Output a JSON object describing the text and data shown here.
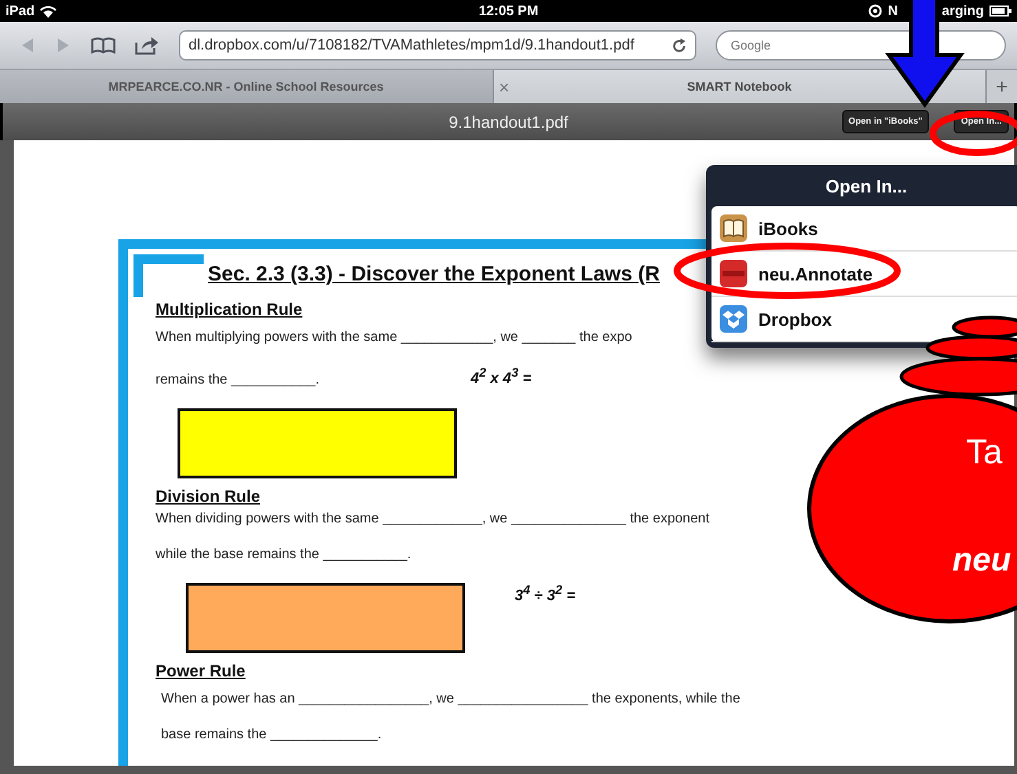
{
  "status_bar": {
    "device": "iPad",
    "time": "12:05 PM",
    "right_text_1": "N",
    "right_text_2": "arging"
  },
  "browser": {
    "url": "dl.dropbox.com/u/7108182/TVAMathletes/mpm1d/9.1handout1.pdf",
    "search_placeholder": "Google",
    "tabs": [
      {
        "label": "MRPEARCE.CO.NR - Online School Resources",
        "selected": false
      },
      {
        "label": "SMART Notebook",
        "selected": true
      }
    ],
    "close_glyph": "×",
    "new_tab_glyph": "+"
  },
  "pdf_bar": {
    "title": "9.1handout1.pdf",
    "buttons": [
      "Open in \"iBooks\"",
      "Open In..."
    ]
  },
  "document": {
    "title": "Sec. 2.3 (3.3) - Discover the Exponent Laws (R",
    "sections": [
      {
        "heading": "Multiplication Rule",
        "kind": "expr-inline",
        "lines": [
          "When multiplying powers with the same ____________, we _______ the expo",
          "remains the ___________."
        ],
        "expression": "4$^{2}$ x 4$^{3}$ =",
        "color": "#ffff00"
      },
      {
        "heading": "Division Rule",
        "kind": "expr-beside-box",
        "lines": [
          "When dividing powers with the same _____________, we _______________ the exponent",
          "while the base remains the ___________."
        ],
        "expression": "3$^{4}$ ÷ 3$^{2}$ =",
        "color": "#ffa95a"
      },
      {
        "heading": "Power Rule",
        "kind": "text-only",
        "lines": [
          "When a power has an _________________, we _________________ the exponents, while the",
          "base remains the ______________."
        ]
      }
    ]
  },
  "popover": {
    "title": "Open In...",
    "items": [
      {
        "label": "iBooks"
      },
      {
        "label": "neu.Annotate"
      },
      {
        "label": "Dropbox"
      }
    ]
  },
  "callout": {
    "lines": [
      "Ta",
      "neu"
    ]
  }
}
